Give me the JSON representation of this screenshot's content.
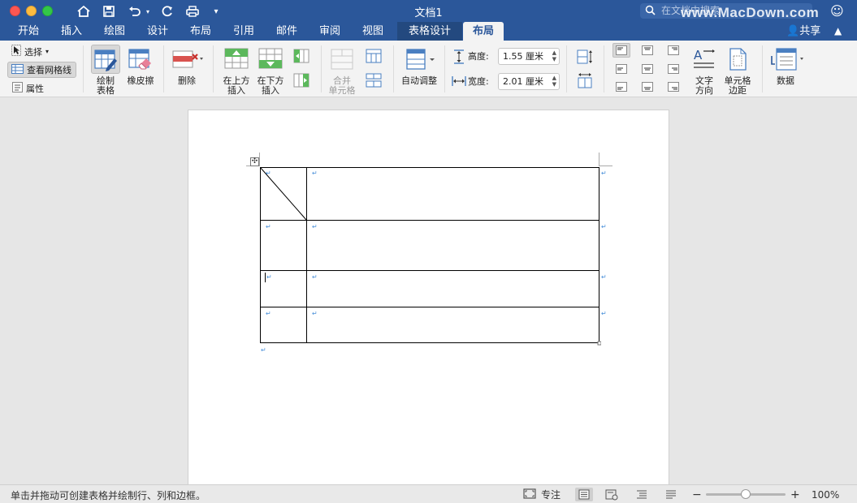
{
  "window": {
    "title": "文档1",
    "search_placeholder": "在文档中搜索",
    "watermark": "www.MacDown.com"
  },
  "tabs": [
    {
      "label": "开始"
    },
    {
      "label": "插入"
    },
    {
      "label": "绘图"
    },
    {
      "label": "设计"
    },
    {
      "label": "布局"
    },
    {
      "label": "引用"
    },
    {
      "label": "邮件"
    },
    {
      "label": "审阅"
    },
    {
      "label": "视图"
    },
    {
      "label": "表格设计"
    },
    {
      "label": "布局"
    }
  ],
  "share_label": "共享",
  "ribbon": {
    "select_label": "选择",
    "gridlines_label": "查看网格线",
    "properties_label": "属性",
    "draw_table_line1": "绘制",
    "draw_table_line2": "表格",
    "eraser_label": "橡皮擦",
    "delete_label": "删除",
    "insert_above_line1": "在上方",
    "insert_above_line2": "插入",
    "insert_below_line1": "在下方",
    "insert_below_line2": "插入",
    "merge_line1": "合并",
    "merge_line2": "单元格",
    "autofit_label": "自动调整",
    "height_label": "高度:",
    "height_value": "1.55 厘米",
    "width_label": "宽度:",
    "width_value": "2.01 厘米",
    "text_direction_line1": "文字",
    "text_direction_line2": "方向",
    "cell_margins_line1": "单元格",
    "cell_margins_line2": "边距",
    "data_label": "数据"
  },
  "status": {
    "message": "单击并拖动可创建表格并绘制行、列和边框。",
    "focus_label": "专注",
    "zoom": "100%",
    "zoom_level": 0.5
  },
  "colors": {
    "titlebar": "#2b579a",
    "accent": "#2b579a",
    "para_mark": "#4a90d9"
  }
}
